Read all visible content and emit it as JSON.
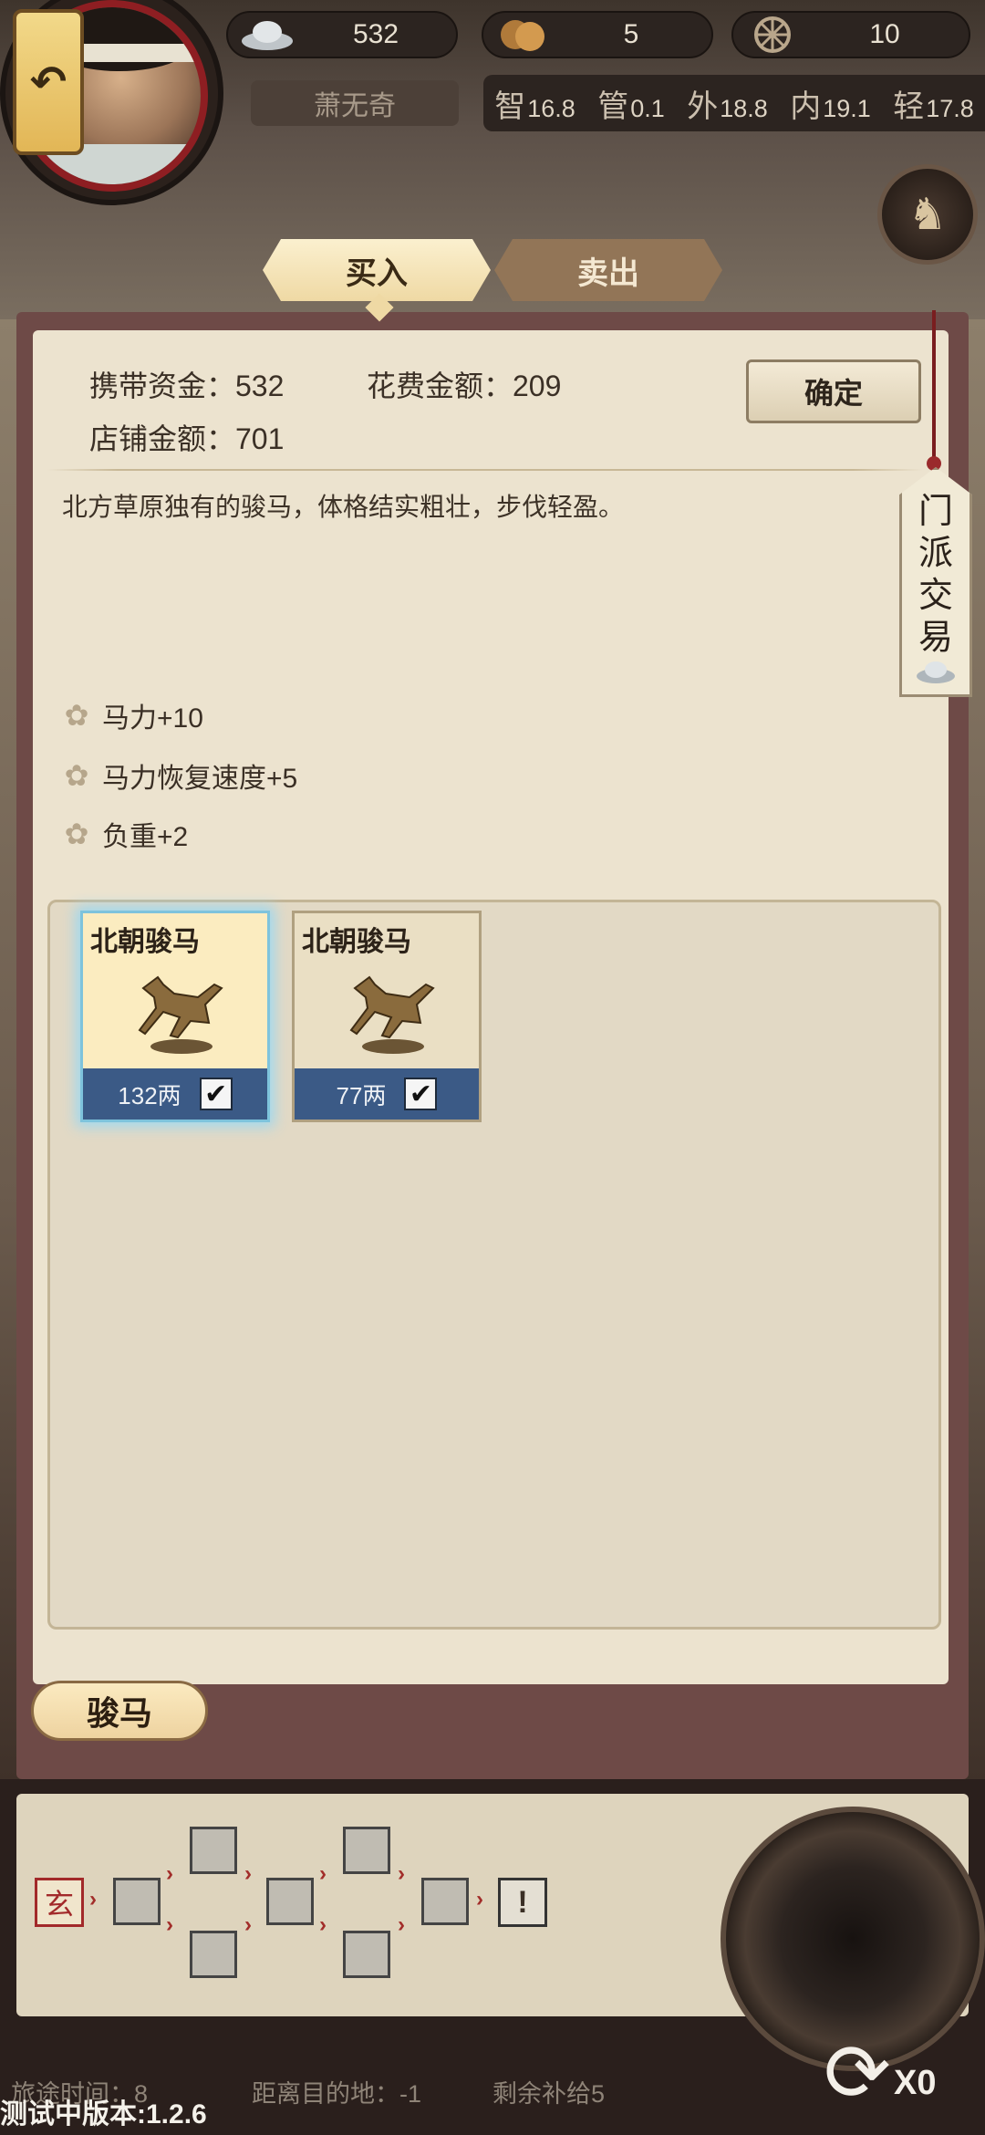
{
  "header": {
    "player_name": "萧无奇",
    "resources": [
      {
        "icon": "silver-ingot-icon",
        "value": "532"
      },
      {
        "icon": "copper-coins-icon",
        "value": "5"
      },
      {
        "icon": "wheel-icon",
        "value": "10"
      }
    ],
    "stats": [
      {
        "glyph": "智",
        "value": "16.8"
      },
      {
        "glyph": "管",
        "value": "0.1"
      },
      {
        "glyph": "外",
        "value": "18.8"
      },
      {
        "glyph": "内",
        "value": "19.1"
      },
      {
        "glyph": "轻",
        "value": "17.8"
      }
    ]
  },
  "tabs": {
    "buy": "买入",
    "sell": "卖出"
  },
  "trade": {
    "carry_funds": "携带资金：532",
    "cost_amount": "花费金额：209",
    "shop_amount": "店铺金额：701",
    "confirm": "确定"
  },
  "side_tag": [
    "门",
    "派",
    "交",
    "易"
  ],
  "item": {
    "description": "北方草原独有的骏马，体格结实粗壮，步伐轻盈。",
    "attributes": [
      "马力+10",
      "马力恢复速度+5",
      "负重+2"
    ]
  },
  "cards": [
    {
      "name": "北朝骏马",
      "price": "132两",
      "checked": true,
      "selected": true
    },
    {
      "name": "北朝骏马",
      "price": "77两",
      "checked": true,
      "selected": false
    }
  ],
  "category_button": "骏马",
  "route": {
    "start_seal": "玄",
    "end_mark": "!"
  },
  "status": {
    "travel_time": "旅途时间：8",
    "distance": "距离目的地：-1",
    "supplies": "剩余补给5",
    "refresh_count": "X0"
  },
  "version": "测试中版本:1.2.6"
}
